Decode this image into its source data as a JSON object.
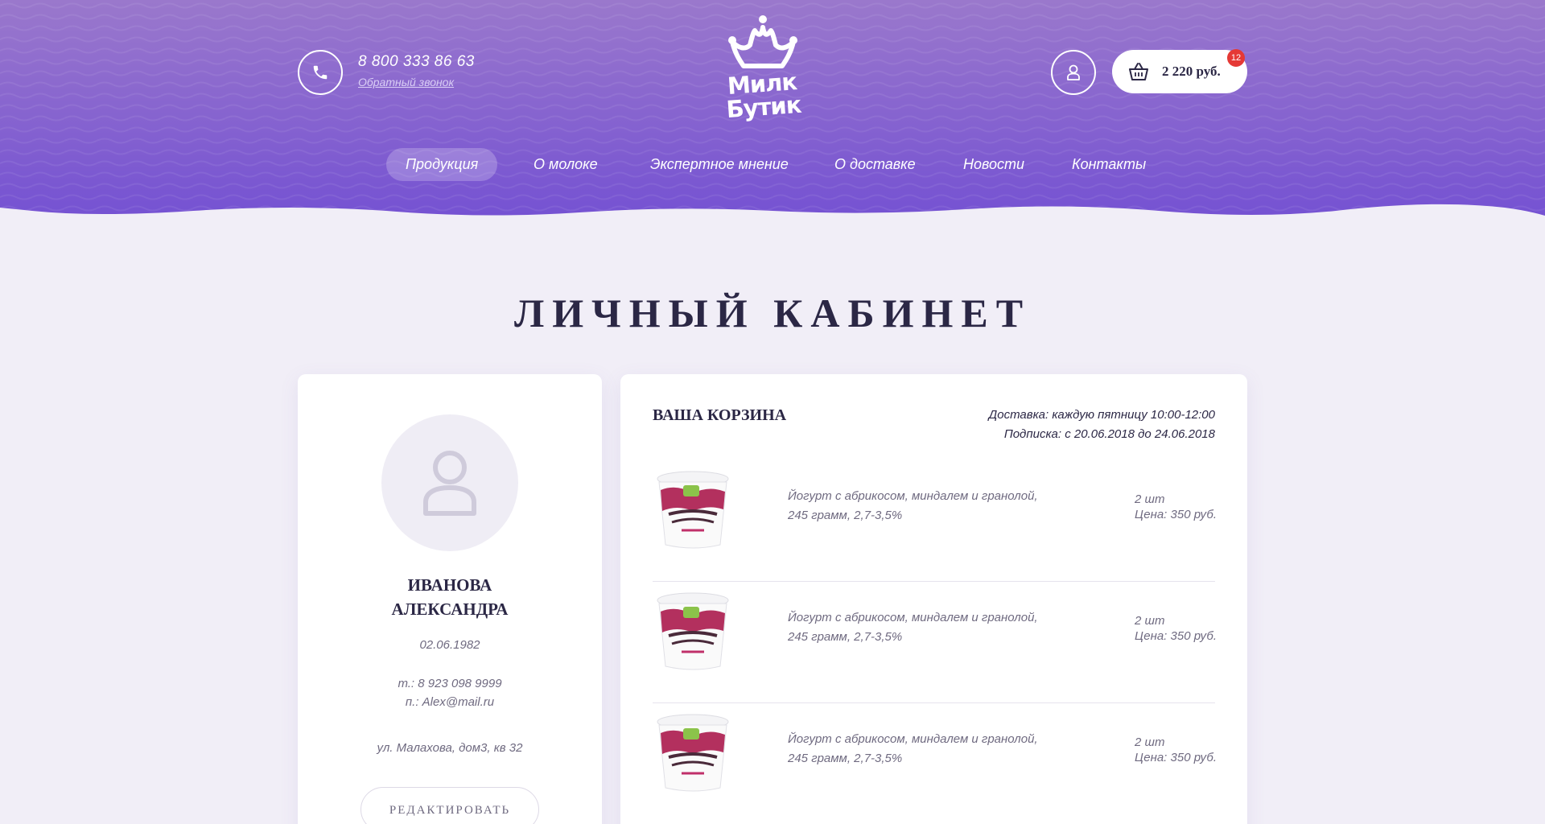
{
  "header": {
    "phone_number": "8 800 333 86 63",
    "callback_link": "Обратный звонок",
    "logo_line1": "Милк",
    "logo_line2": "Бутик",
    "cart_total": "2 220 руб.",
    "cart_count": "12",
    "icons": [
      "phone-icon",
      "user-icon",
      "basket-icon",
      "crown-icon"
    ],
    "colors": {
      "header_top": "#9a78cc",
      "header_bottom": "#7552d2",
      "badge": "#e53935"
    }
  },
  "nav": {
    "items": [
      {
        "label": "Продукция",
        "active": true
      },
      {
        "label": "О молоке",
        "active": false
      },
      {
        "label": "Экспертное мнение",
        "active": false
      },
      {
        "label": "О доставке",
        "active": false
      },
      {
        "label": "Новости",
        "active": false
      },
      {
        "label": "Контакты",
        "active": false
      }
    ]
  },
  "page": {
    "title": "ЛИЧНЫЙ КАБИНЕТ"
  },
  "profile": {
    "name_line1": "ИВАНОВА",
    "name_line2": "АЛЕКСАНДРА",
    "birth_date": "02.06.1982",
    "phone": "т.: 8 923 098 9999",
    "email": "п.: Alex@mail.ru",
    "address": "ул. Малахова, дом3, кв 32",
    "edit_button": "РЕДАКТИРОВАТЬ"
  },
  "cart": {
    "title": "ВАША КОРЗИНА",
    "delivery": "Доставка: каждую пятницу 10:00-12:00",
    "subscription": "Подписка: с 20.06.2018 до 24.06.2018",
    "items": [
      {
        "name_line1": "Йогурт с абрикосом, миндалем и гранолой,",
        "name_line2": "245 грамм, 2,7-3,5%",
        "qty": "2 шт",
        "price": "Цена: 350 руб."
      },
      {
        "name_line1": "Йогурт с абрикосом, миндалем и гранолой,",
        "name_line2": "245 грамм, 2,7-3,5%",
        "qty": "2 шт",
        "price": "Цена: 350 руб."
      },
      {
        "name_line1": "Йогурт с абрикосом, миндалем и гранолой,",
        "name_line2": "245 грамм, 2,7-3,5%",
        "qty": "2 шт",
        "price": "Цена: 350 руб."
      }
    ]
  }
}
